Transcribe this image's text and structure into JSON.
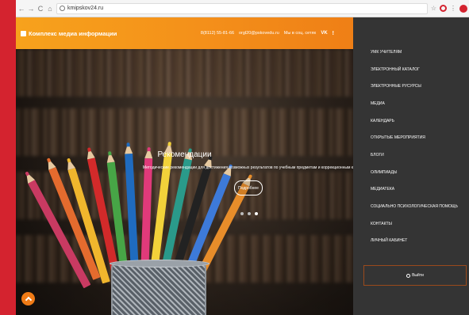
{
  "browser": {
    "url": "kmipskov24.ru",
    "back_icon": "←",
    "forward_icon": "→",
    "reload_icon": "C",
    "home_icon": "⌂",
    "star_icon": "☆"
  },
  "header": {
    "logo_text": "Комплекс медиа информации",
    "phone": "8(8112) 55-81-66",
    "email": "orgl20@pskovedu.ru",
    "social_text": "Мы в соц. сетях",
    "vk_label": "VK",
    "ok_label": "!"
  },
  "slide": {
    "title": "Рекомендации",
    "text": "Методические рекомендации для достижения возможных результатов по учебным предметам и коррекционным к",
    "more_button": "Подробнее",
    "dots": 3,
    "active_dot": 3
  },
  "menu": {
    "items": [
      "УМК УЧИТЕЛЯМ",
      "ЭЛЕКТРОННЫЙ КАТАЛОГ",
      "ЭЛЕКТРОННЫЕ РУСУРСЫ",
      "МЕДИА",
      "КАЛЕНДАРЬ",
      "ОТКРЫТЫЕ МЕРОПРИЯТИЯ",
      "БЛОГИ",
      "ОЛИМПИАДЫ",
      "МЕДИАТЕКА",
      "СОЦИАЛЬНО ПСИХОЛОГИЧЕСКАЯ ПОМОЩЬ",
      "КОНТАКТЫ",
      "ЛИЧНЫЙ КАБИНЕТ"
    ],
    "logout": "Выйти"
  },
  "colors": {
    "accent": "#f4901a",
    "sidebar_bg": "#343434",
    "left_strip": "#d4232f"
  }
}
